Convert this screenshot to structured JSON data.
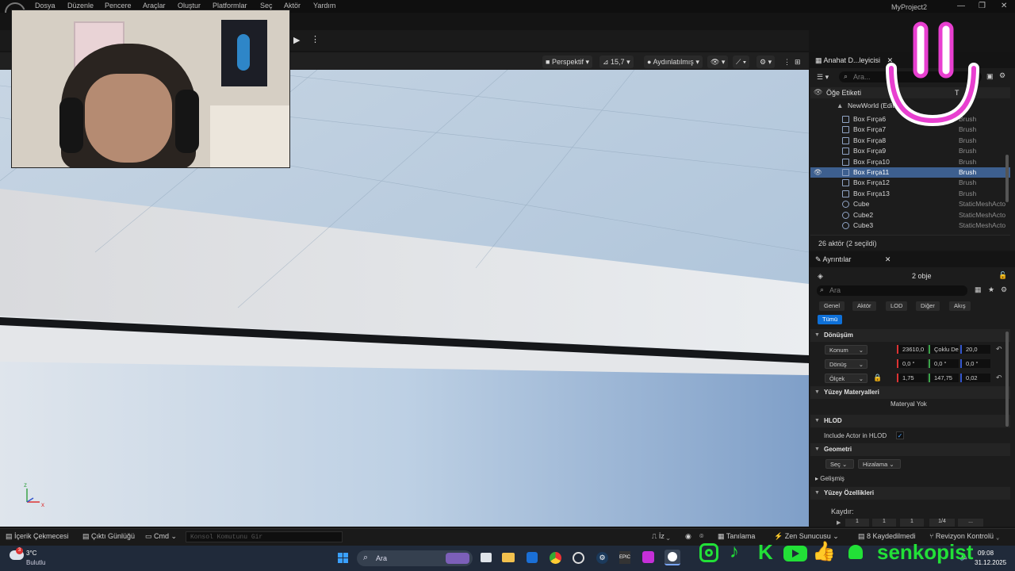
{
  "menu": {
    "items": [
      "Dosya",
      "Düzenle",
      "Pencere",
      "Araçlar",
      "Oluştur",
      "Platformlar",
      "Seç",
      "Aktör",
      "Yardım"
    ],
    "project_title": "MyProject2"
  },
  "viewport": {
    "perspective": "Perspektif",
    "fov": "15,7",
    "lighting": "Aydınlatılmış",
    "axis_labels": {
      "z": "z",
      "x": "x"
    }
  },
  "outliner": {
    "tab_title": "Anahat D...leyicisi",
    "search_placeholder": "Ara...",
    "column_label": "Öğe Etiketi",
    "column_type": "T",
    "world_root": "NewWorld (Edito",
    "rows": [
      {
        "name": "Box Fırça6",
        "type": "Brush"
      },
      {
        "name": "Box Fırça7",
        "type": "Brush"
      },
      {
        "name": "Box Fırça8",
        "type": "Brush"
      },
      {
        "name": "Box Fırça9",
        "type": "Brush"
      },
      {
        "name": "Box Fırça10",
        "type": "Brush"
      },
      {
        "name": "Box Fırça11",
        "type": "Brush"
      },
      {
        "name": "Box Fırça12",
        "type": "Brush"
      },
      {
        "name": "Box Fırça13",
        "type": "Brush"
      },
      {
        "name": "Cube",
        "type": "StaticMeshActo"
      },
      {
        "name": "Cube2",
        "type": "StaticMeshActo"
      },
      {
        "name": "Cube3",
        "type": "StaticMeshActo"
      }
    ],
    "selected_row": "Box Fırça11",
    "footer": "26 aktör (2 seçildi)"
  },
  "details": {
    "tab_title": "Ayrıntılar",
    "object_count": "2 obje",
    "search_placeholder": "Ara",
    "categories": [
      "Genel",
      "Aktör",
      "LOD",
      "Diğer",
      "Akış"
    ],
    "active_category": "Tümü",
    "transform": {
      "section": "Dönüşüm",
      "location_label": "Konum",
      "location": [
        "23610,0",
        "Çoklu De",
        "20,0"
      ],
      "rotation_label": "Dönüş",
      "rotation": [
        "0,0 °",
        "0,0 °",
        "0,0 °"
      ],
      "scale_label": "Ölçek",
      "scale": [
        "1,75",
        "147,75",
        "0,02"
      ]
    },
    "surface_materials": {
      "section": "Yüzey Materyalleri",
      "value": "Materyal Yok"
    },
    "hlod": {
      "section": "HLOD",
      "include_label": "Include Actor in HLOD",
      "include_checked": true
    },
    "geometry": {
      "section": "Geometri",
      "select_label": "Seç",
      "align_label": "Hizalama",
      "advanced": "Gelişmiş"
    },
    "surface_props": {
      "section": "Yüzey Özellikleri",
      "pan_label": "Kaydır:",
      "pan_values": [
        "1",
        "1",
        "1",
        "1/4",
        "..."
      ]
    }
  },
  "statusbar": {
    "content_drawer": "İçerik Çekmecesi",
    "output_log": "Çıktı Günlüğü",
    "cmd": "Cmd",
    "console_placeholder": "Konsol Komutunu Gir",
    "trace": "İz",
    "diagnostics": "Tanılama",
    "zen": "Zen Sunucusu",
    "unsaved": "8 Kaydedilmedi",
    "revision": "Revizyon Kontrolü"
  },
  "taskbar": {
    "weather_temp": "3°C",
    "weather_desc": "Bulutlu",
    "weather_badge": "3",
    "search": "Ara",
    "time": "09:08",
    "date": "31.12.2025"
  },
  "overlay": {
    "brand": "senkopist"
  },
  "colors": {
    "accent": "#0e70d8",
    "selection": "#3d5f8f",
    "social_green": "#22e037",
    "smiley": "#e83fd0"
  }
}
